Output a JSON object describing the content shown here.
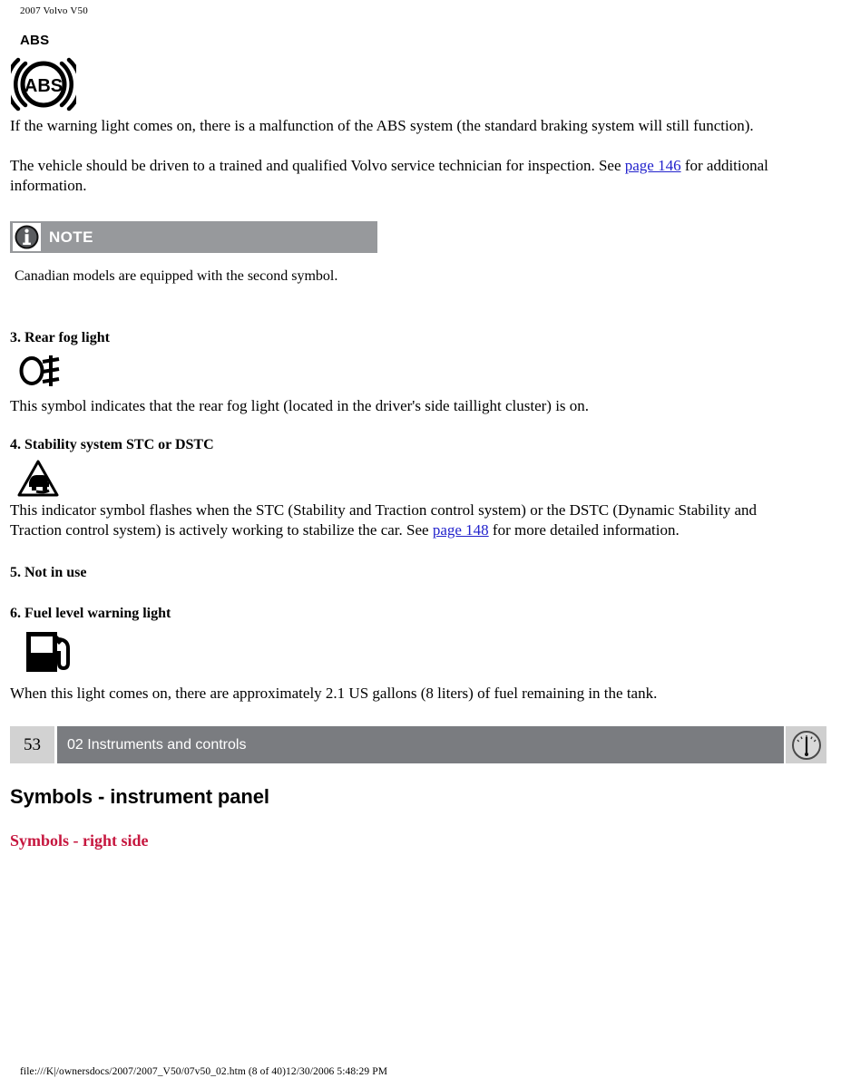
{
  "document": {
    "running_header": "2007 Volvo V50",
    "file_path": "file:///K|/ownersdocs/2007/2007_V50/07v50_02.htm (8 of 40)12/30/2006 5:48:29 PM"
  },
  "abs_section": {
    "heading": "ABS",
    "symbol_name": "abs-warning-symbol",
    "symbol_text": "ABS",
    "paragraph1": "If the warning light comes on, there is a malfunction of the ABS system (the standard braking system will still function).",
    "paragraph2_before": "The vehicle should be driven to a trained and qualified Volvo service technician for inspection. See ",
    "paragraph2_link": "page 146",
    "paragraph2_after": " for additional information."
  },
  "note": {
    "label": "NOTE",
    "icon_name": "info-icon",
    "icon_glyph": "i",
    "text": "Canadian models are equipped with the second symbol."
  },
  "item3": {
    "heading": "3. Rear fog light",
    "symbol_name": "rear-fog-light-symbol",
    "text": "This symbol indicates that the rear fog light (located in the driver's side taillight cluster) is on."
  },
  "item4": {
    "heading": "4. Stability system STC or DSTC",
    "symbol_name": "stc-dstc-symbol",
    "text_before": "This indicator symbol flashes when the STC (Stability and Traction control system) or the DSTC (Dynamic Stability and Traction control system) is actively working to stabilize the car. See ",
    "text_link": "page 148",
    "text_after": " for more detailed information."
  },
  "item5": {
    "heading": "5. Not in use"
  },
  "item6": {
    "heading": "6. Fuel level warning light",
    "symbol_name": "fuel-pump-symbol",
    "text": "When this light comes on, there are approximately 2.1 US gallons (8 liters) of fuel remaining in the tank."
  },
  "footer": {
    "page_number": "53",
    "chapter": "02 Instruments and controls",
    "gauge_icon_name": "instrument-gauge-icon"
  },
  "next_section": {
    "title": "Symbols - instrument panel",
    "subtitle": "Symbols - right side"
  },
  "colors": {
    "note_bar_gray": "#97999c",
    "footer_bar_gray": "#7a7c80",
    "footer_pageno_gray": "#d2d2d2",
    "link_blue": "#2222cc",
    "section_sub_red": "#c6173f"
  }
}
